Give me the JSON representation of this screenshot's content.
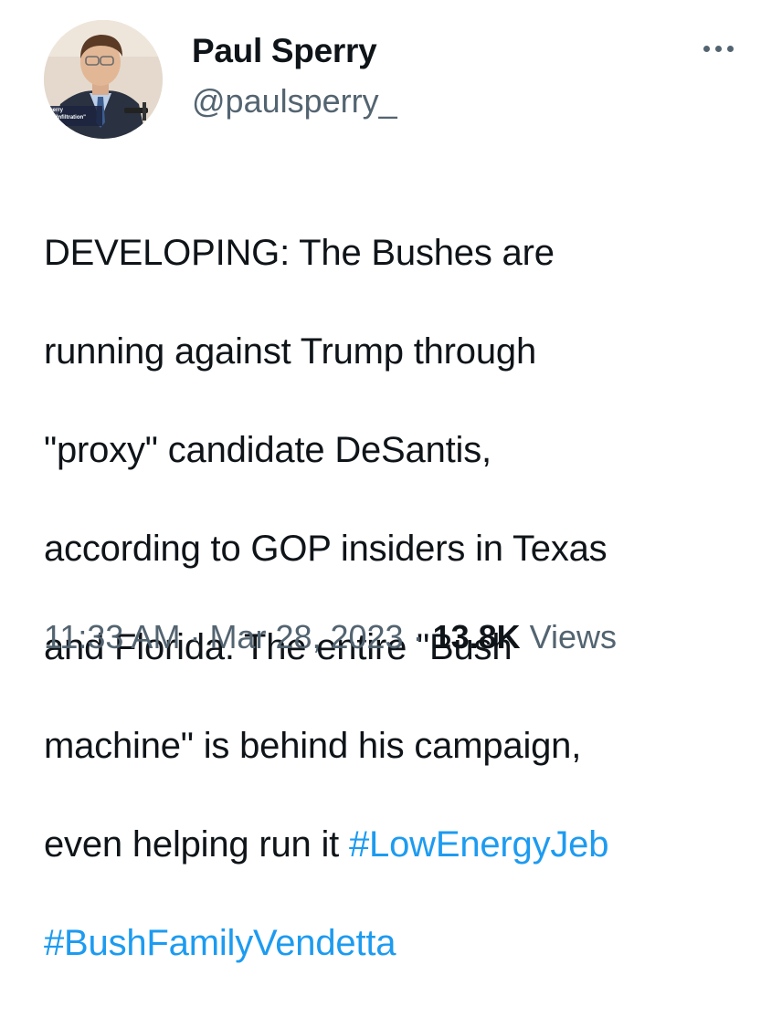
{
  "author": {
    "display_name": "Paul Sperry",
    "handle": "@paulsperry_",
    "avatar_caption_line1": "Sperry",
    "avatar_caption_line2": "or, \"Infiltration\""
  },
  "tweet": {
    "lines": [
      "DEVELOPING: The Bushes are",
      "running against Trump through",
      "\"proxy\" candidate DeSantis,",
      "according to GOP insiders in Texas",
      "and Florida. The entire \"Bush",
      "machine\" is behind his campaign,"
    ],
    "last_line_prefix": "even helping run it ",
    "hashtag_1": "#LowEnergyJeb",
    "hashtag_2": "#BushFamilyVendetta"
  },
  "meta": {
    "time": "11:33 AM",
    "separator": " · ",
    "date": "Mar 28, 2023",
    "views_count": "13.8K",
    "views_label": " Views"
  },
  "icons": {
    "more": "more-horizontal-icon"
  },
  "colors": {
    "text": "#0f1419",
    "secondary": "#536471",
    "link": "#1d9bf0",
    "background": "#ffffff"
  }
}
